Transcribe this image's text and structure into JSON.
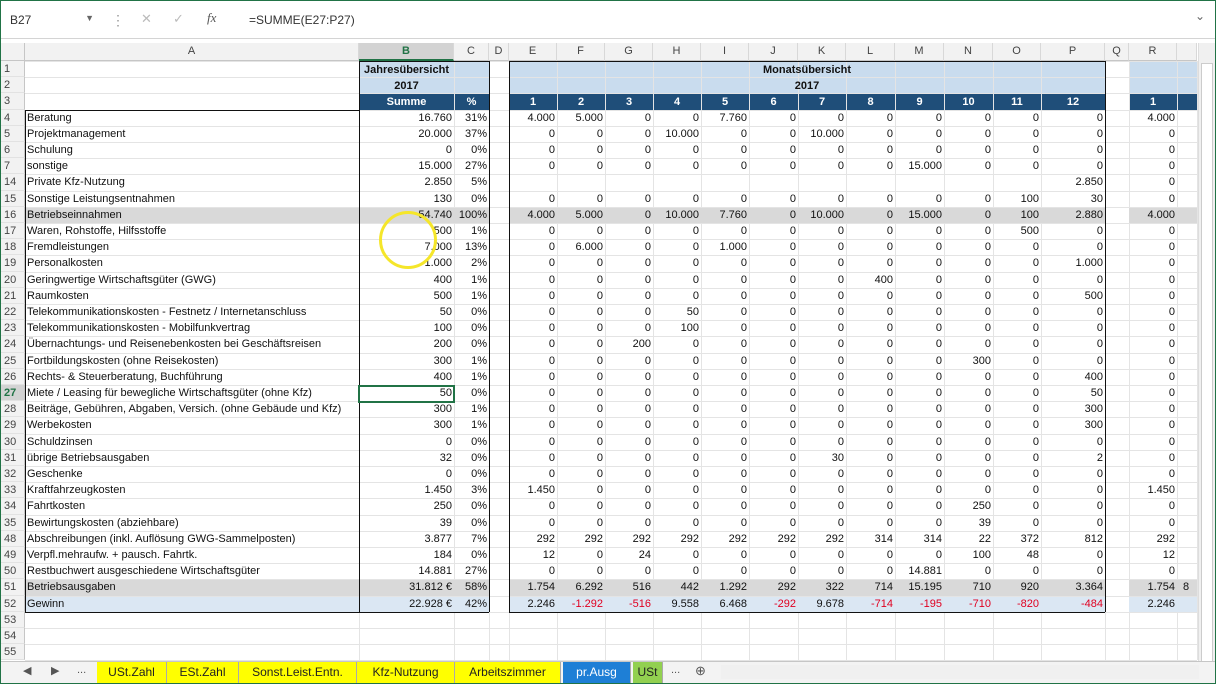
{
  "formula_bar": {
    "namebox": "B27",
    "fx": "fx",
    "formula": "=SUMME(E27:P27)"
  },
  "columns": [
    "A",
    "B",
    "C",
    "D",
    "E",
    "F",
    "G",
    "H",
    "I",
    "J",
    "K",
    "L",
    "M",
    "N",
    "O",
    "P",
    "Q",
    "R"
  ],
  "row_numbers": [
    "1",
    "2",
    "3",
    "4",
    "5",
    "6",
    "7",
    "14",
    "15",
    "16",
    "17",
    "18",
    "19",
    "20",
    "21",
    "22",
    "23",
    "24",
    "25",
    "26",
    "27",
    "28",
    "29",
    "30",
    "31",
    "32",
    "33",
    "34",
    "35",
    "48",
    "49",
    "50",
    "51",
    "52",
    "53",
    "54",
    "55"
  ],
  "headers": {
    "jahres_title": "Jahresübersicht",
    "jahres_year": "2017",
    "summe": "Summe",
    "pct": "%",
    "monats_title": "Monatsübersicht",
    "monats_year": "2017",
    "months": [
      "1",
      "2",
      "3",
      "4",
      "5",
      "6",
      "7",
      "8",
      "9",
      "10",
      "11",
      "12"
    ],
    "r_month": "1"
  },
  "rows": [
    {
      "label": "Beratung",
      "sum": "16.760",
      "pct": "31%",
      "m": [
        "4.000",
        "5.000",
        "0",
        "0",
        "7.760",
        "0",
        "0",
        "0",
        "0",
        "0",
        "0",
        "0"
      ],
      "r": "4.000"
    },
    {
      "label": "Projektmanagement",
      "sum": "20.000",
      "pct": "37%",
      "m": [
        "0",
        "0",
        "0",
        "10.000",
        "0",
        "0",
        "10.000",
        "0",
        "0",
        "0",
        "0",
        "0"
      ],
      "r": "0"
    },
    {
      "label": "Schulung",
      "sum": "0",
      "pct": "0%",
      "m": [
        "0",
        "0",
        "0",
        "0",
        "0",
        "0",
        "0",
        "0",
        "0",
        "0",
        "0",
        "0"
      ],
      "r": "0"
    },
    {
      "label": "sonstige",
      "sum": "15.000",
      "pct": "27%",
      "m": [
        "0",
        "0",
        "0",
        "0",
        "0",
        "0",
        "0",
        "0",
        "15.000",
        "0",
        "0",
        "0"
      ],
      "r": "0"
    },
    {
      "label": "Private Kfz-Nutzung",
      "sum": "2.850",
      "pct": "5%",
      "m": [
        "",
        "",
        "",
        "",
        "",
        "",
        "",
        "",
        "",
        "",
        "",
        "2.850"
      ],
      "r": "0"
    },
    {
      "label": "Sonstige Leistungsentnahmen",
      "sum": "130",
      "pct": "0%",
      "m": [
        "0",
        "0",
        "0",
        "0",
        "0",
        "0",
        "0",
        "0",
        "0",
        "0",
        "100",
        "30"
      ],
      "r": "0"
    },
    {
      "label": "Betriebseinnahmen",
      "sum": "54.740",
      "pct": "100%",
      "m": [
        "4.000",
        "5.000",
        "0",
        "10.000",
        "7.760",
        "0",
        "10.000",
        "0",
        "15.000",
        "0",
        "100",
        "2.880"
      ],
      "r": "4.000",
      "total": true
    },
    {
      "label": "Waren, Rohstoffe, Hilfsstoffe",
      "sum": "500",
      "pct": "1%",
      "m": [
        "0",
        "0",
        "0",
        "0",
        "0",
        "0",
        "0",
        "0",
        "0",
        "0",
        "500",
        "0"
      ],
      "r": "0"
    },
    {
      "label": "Fremdleistungen",
      "sum": "7.000",
      "pct": "13%",
      "m": [
        "0",
        "6.000",
        "0",
        "0",
        "1.000",
        "0",
        "0",
        "0",
        "0",
        "0",
        "0",
        "0"
      ],
      "r": "0"
    },
    {
      "label": "Personalkosten",
      "sum": "1.000",
      "pct": "2%",
      "m": [
        "0",
        "0",
        "0",
        "0",
        "0",
        "0",
        "0",
        "0",
        "0",
        "0",
        "0",
        "1.000"
      ],
      "r": "0"
    },
    {
      "label": "Geringwertige Wirtschaftsgüter (GWG)",
      "sum": "400",
      "pct": "1%",
      "m": [
        "0",
        "0",
        "0",
        "0",
        "0",
        "0",
        "0",
        "400",
        "0",
        "0",
        "0",
        "0"
      ],
      "r": "0"
    },
    {
      "label": "Raumkosten",
      "sum": "500",
      "pct": "1%",
      "m": [
        "0",
        "0",
        "0",
        "0",
        "0",
        "0",
        "0",
        "0",
        "0",
        "0",
        "0",
        "500"
      ],
      "r": "0"
    },
    {
      "label": "Telekommunikationskosten - Festnetz / Internetanschluss",
      "sum": "50",
      "pct": "0%",
      "m": [
        "0",
        "0",
        "0",
        "50",
        "0",
        "0",
        "0",
        "0",
        "0",
        "0",
        "0",
        "0"
      ],
      "r": "0"
    },
    {
      "label": "Telekommunikationskosten - Mobilfunkvertrag",
      "sum": "100",
      "pct": "0%",
      "m": [
        "0",
        "0",
        "0",
        "100",
        "0",
        "0",
        "0",
        "0",
        "0",
        "0",
        "0",
        "0"
      ],
      "r": "0"
    },
    {
      "label": "Übernachtungs- und Reisenebenkosten bei Geschäftsreisen",
      "sum": "200",
      "pct": "0%",
      "m": [
        "0",
        "0",
        "200",
        "0",
        "0",
        "0",
        "0",
        "0",
        "0",
        "0",
        "0",
        "0"
      ],
      "r": "0"
    },
    {
      "label": "Fortbildungskosten (ohne Reisekosten)",
      "sum": "300",
      "pct": "1%",
      "m": [
        "0",
        "0",
        "0",
        "0",
        "0",
        "0",
        "0",
        "0",
        "0",
        "300",
        "0",
        "0"
      ],
      "r": "0"
    },
    {
      "label": "Rechts- & Steuerberatung, Buchführung",
      "sum": "400",
      "pct": "1%",
      "m": [
        "0",
        "0",
        "0",
        "0",
        "0",
        "0",
        "0",
        "0",
        "0",
        "0",
        "0",
        "400"
      ],
      "r": "0"
    },
    {
      "label": "Miete / Leasing für bewegliche Wirtschaftsgüter (ohne Kfz)",
      "sum": "50",
      "pct": "0%",
      "m": [
        "0",
        "0",
        "0",
        "0",
        "0",
        "0",
        "0",
        "0",
        "0",
        "0",
        "0",
        "50"
      ],
      "r": "0"
    },
    {
      "label": "Beiträge, Gebühren, Abgaben, Versich. (ohne Gebäude und Kfz)",
      "sum": "300",
      "pct": "1%",
      "m": [
        "0",
        "0",
        "0",
        "0",
        "0",
        "0",
        "0",
        "0",
        "0",
        "0",
        "0",
        "300"
      ],
      "r": "0"
    },
    {
      "label": "Werbekosten",
      "sum": "300",
      "pct": "1%",
      "m": [
        "0",
        "0",
        "0",
        "0",
        "0",
        "0",
        "0",
        "0",
        "0",
        "0",
        "0",
        "300"
      ],
      "r": "0"
    },
    {
      "label": "Schuldzinsen",
      "sum": "0",
      "pct": "0%",
      "m": [
        "0",
        "0",
        "0",
        "0",
        "0",
        "0",
        "0",
        "0",
        "0",
        "0",
        "0",
        "0"
      ],
      "r": "0"
    },
    {
      "label": "übrige Betriebsausgaben",
      "sum": "32",
      "pct": "0%",
      "m": [
        "0",
        "0",
        "0",
        "0",
        "0",
        "0",
        "30",
        "0",
        "0",
        "0",
        "0",
        "2"
      ],
      "r": "0"
    },
    {
      "label": "Geschenke",
      "sum": "0",
      "pct": "0%",
      "m": [
        "0",
        "0",
        "0",
        "0",
        "0",
        "0",
        "0",
        "0",
        "0",
        "0",
        "0",
        "0"
      ],
      "r": "0"
    },
    {
      "label": "Kraftfahrzeugkosten",
      "sum": "1.450",
      "pct": "3%",
      "m": [
        "1.450",
        "0",
        "0",
        "0",
        "0",
        "0",
        "0",
        "0",
        "0",
        "0",
        "0",
        "0"
      ],
      "r": "1.450"
    },
    {
      "label": "Fahrtkosten",
      "sum": "250",
      "pct": "0%",
      "m": [
        "0",
        "0",
        "0",
        "0",
        "0",
        "0",
        "0",
        "0",
        "0",
        "250",
        "0",
        "0"
      ],
      "r": "0"
    },
    {
      "label": "Bewirtungskosten (abziehbare)",
      "sum": "39",
      "pct": "0%",
      "m": [
        "0",
        "0",
        "0",
        "0",
        "0",
        "0",
        "0",
        "0",
        "0",
        "39",
        "0",
        "0"
      ],
      "r": "0"
    },
    {
      "label": "Abschreibungen (inkl. Auflösung GWG-Sammelposten)",
      "sum": "3.877",
      "pct": "7%",
      "m": [
        "292",
        "292",
        "292",
        "292",
        "292",
        "292",
        "292",
        "314",
        "314",
        "22",
        "372",
        "812"
      ],
      "r": "292"
    },
    {
      "label": "Verpfl.mehraufw. + pausch. Fahrtk.",
      "sum": "184",
      "pct": "0%",
      "m": [
        "12",
        "0",
        "24",
        "0",
        "0",
        "0",
        "0",
        "0",
        "0",
        "100",
        "48",
        "0"
      ],
      "r": "12"
    },
    {
      "label": "Restbuchwert ausgeschiedene Wirtschaftsgüter",
      "sum": "14.881",
      "pct": "27%",
      "m": [
        "0",
        "0",
        "0",
        "0",
        "0",
        "0",
        "0",
        "0",
        "14.881",
        "0",
        "0",
        "0"
      ],
      "r": "0"
    },
    {
      "label": "Betriebsausgaben",
      "sum": "31.812 €",
      "pct": "58%",
      "m": [
        "1.754",
        "6.292",
        "516",
        "442",
        "1.292",
        "292",
        "322",
        "714",
        "15.195",
        "710",
        "920",
        "3.364"
      ],
      "r": "1.754",
      "total": true,
      "r2": "8"
    },
    {
      "label": "Gewinn",
      "sum": "22.928 €",
      "pct": "42%",
      "m": [
        "2.246",
        "-1.292",
        "-516",
        "9.558",
        "6.468",
        "-292",
        "9.678",
        "-714",
        "-195",
        "-710",
        "-820",
        "-484"
      ],
      "r": "2.246",
      "gewinn": true
    }
  ],
  "tabs": [
    "USt.Zahl",
    "ESt.Zahl",
    "Sonst.Leist.Entn.",
    "Kfz-Nutzung",
    "Arbeitszimmer",
    "pr.Ausg",
    "USt"
  ],
  "tab_nav": {
    "prev": "◀",
    "next": "▶",
    "more": "...",
    "add": "⊕"
  }
}
